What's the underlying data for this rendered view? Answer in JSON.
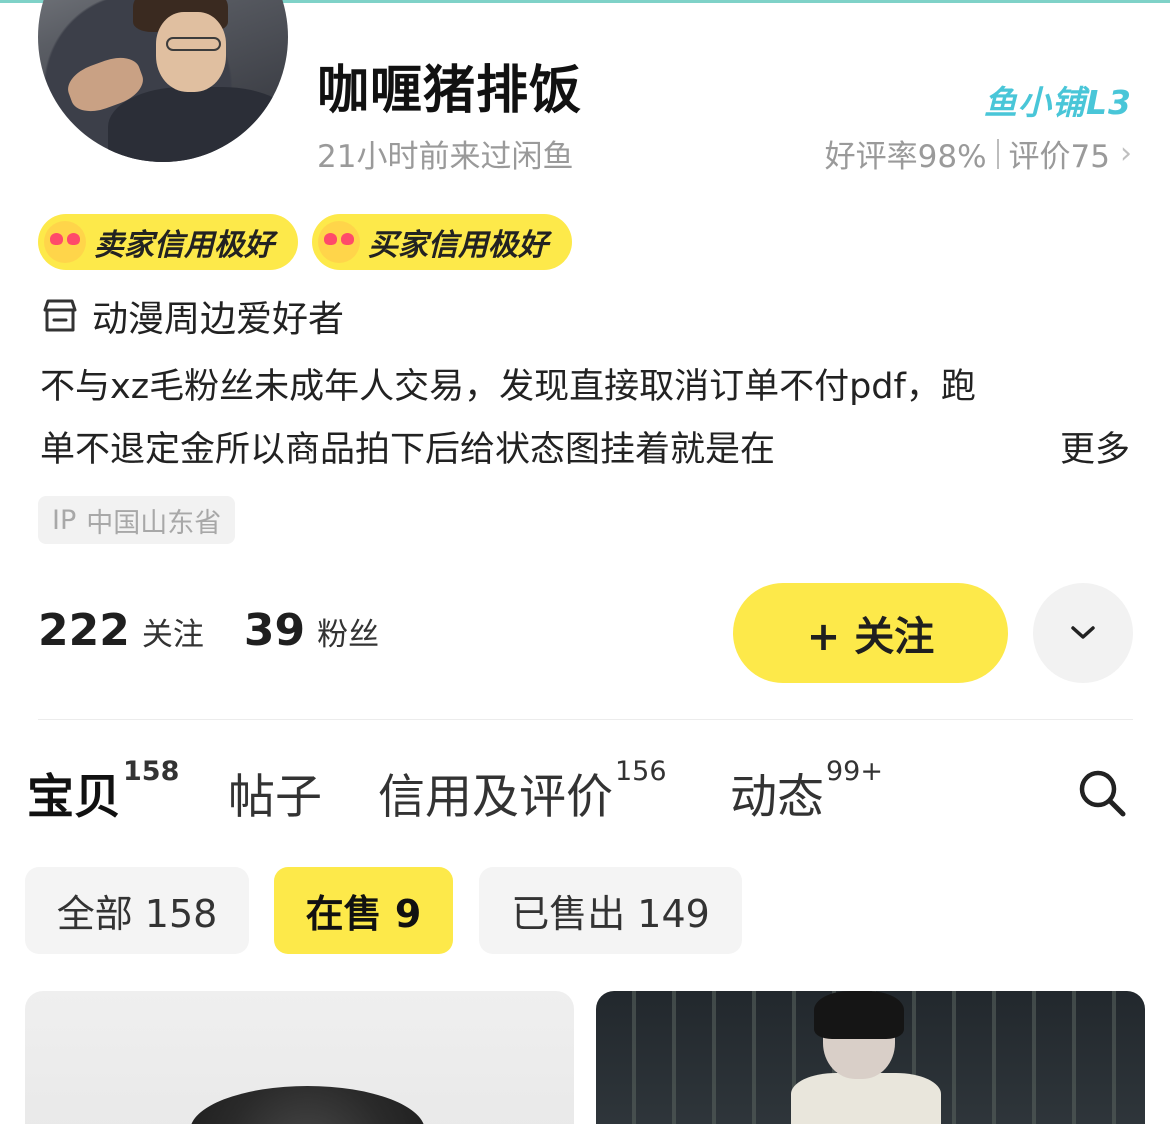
{
  "profile": {
    "username": "咖喱猪排饭",
    "last_seen": "21小时前来过闲鱼",
    "shop_level": "鱼小铺L3",
    "good_rate": "好评率98%",
    "reviews": "评价75",
    "badges": [
      "卖家信用极好",
      "买家信用极好"
    ],
    "interest": "动漫周边爱好者",
    "bio_line1": "不与xz毛粉丝未成年人交易，发现直接取消订单不付pdf，跑",
    "bio_line2": "单不退定金所以商品拍下后给状态图挂着就是在",
    "bio_more": "更多",
    "ip_prefix": "IP",
    "ip_location": "中国山东省"
  },
  "stats": {
    "following_count": "222",
    "following_label": "关注",
    "fans_count": "39",
    "fans_label": "粉丝"
  },
  "actions": {
    "follow_label": "+ 关注"
  },
  "tabs": [
    {
      "label": "宝贝",
      "count": "158"
    },
    {
      "label": "帖子",
      "count": ""
    },
    {
      "label": "信用及评价",
      "count": "156"
    },
    {
      "label": "动态",
      "count": "99+"
    }
  ],
  "filters": [
    {
      "label": "全部 158"
    },
    {
      "label": "在售 9"
    },
    {
      "label": "已售出 149"
    }
  ],
  "colors": {
    "accent_yellow": "#fde94a",
    "shop_level_blue": "#49c6d8",
    "muted_gray": "#9a9a9a"
  }
}
